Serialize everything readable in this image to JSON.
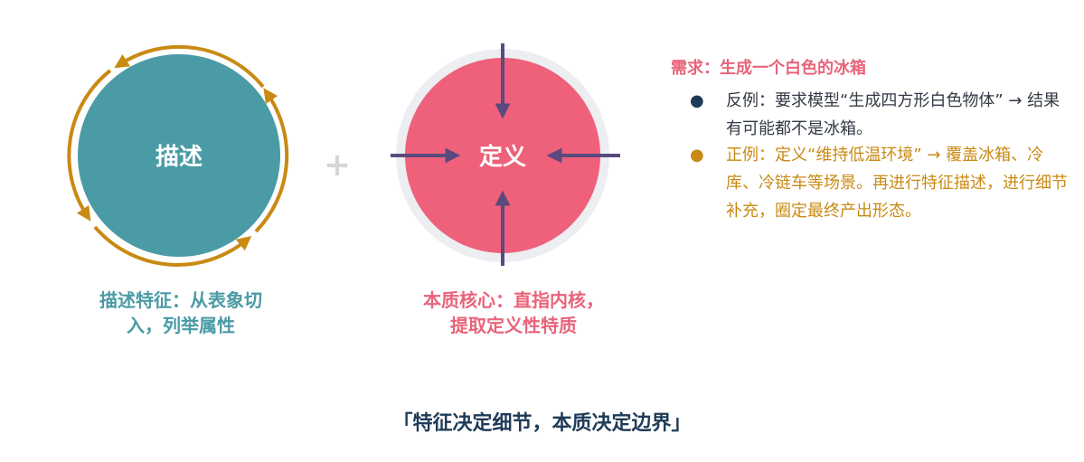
{
  "colors": {
    "teal": "#4a9ba6",
    "pink": "#ef607a",
    "gold": "#c98a14",
    "purple": "#5a4a7e",
    "ring_gray": "#eceef2",
    "navy": "#1f3b57"
  },
  "left_circle": {
    "label": "描述",
    "caption": "描述特征：从表象切入，列举属性"
  },
  "plus_sign": "+",
  "right_circle": {
    "label": "定义",
    "caption": "本质核心：直指内核，提取定义性特质"
  },
  "requirement": {
    "title": "需求：生成一个白色的冰箱",
    "negative": "反例：要求模型“生成四方形白色物体” → 结果有可能都不是冰箱。",
    "positive": "正例：定义“维持低温环境” → 覆盖冰箱、冷库、冷链车等场景。再进行特征描述，进行细节补充，圈定最终产出形态。"
  },
  "bottom_quote": "「特征决定细节，本质决定边界」"
}
